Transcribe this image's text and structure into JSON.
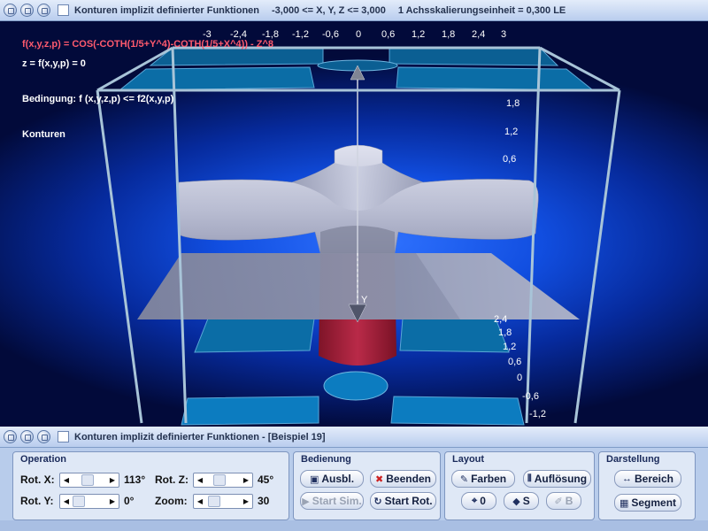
{
  "window": {
    "title": "Konturen implizit definierter Funktionen",
    "range_text": "-3,000 <= X, Y, Z <= 3,000",
    "scale_text": "1 Achsskalierungseinheit = 0,300 LE"
  },
  "overlay": {
    "formula": "f(x,y,z,p) = COS(-COTH(1/5+Y^4)-COTH(1/5+X^4)) - Z^8",
    "equation": "z = f(x,y,p) = 0",
    "condition": "Bedingung: f (x,y,z,p) <= f2(x,y,p)",
    "mode": "Konturen",
    "axis_label_y": "Y",
    "top_ticks": [
      "-3",
      "-2,4",
      "-1,8",
      "-1,2",
      "-0,6",
      "0",
      "0,6",
      "1,2",
      "1,8",
      "2,4",
      "3"
    ],
    "right_ticks": [
      "1,8",
      "1,2",
      "0,6"
    ],
    "right_ticks_low": [
      "2,4",
      "1,8",
      "1,2",
      "0,6",
      "0",
      "-0,6",
      "-1,2"
    ]
  },
  "panel_window": {
    "title": "Konturen implizit definierter Funktionen - [Beispiel 19]"
  },
  "operation": {
    "title": "Operation",
    "rot_x_label": "Rot. X:",
    "rot_x_value": "113°",
    "rot_y_label": "Rot. Y:",
    "rot_y_value": "0°",
    "rot_z_label": "Rot. Z:",
    "rot_z_value": "45°",
    "zoom_label": "Zoom:",
    "zoom_value": "30"
  },
  "bedienung": {
    "title": "Bedienung",
    "ausbl": "Ausbl.",
    "beenden": "Beenden",
    "start_sim": "Start Sim.",
    "start_rot": "Start Rot."
  },
  "layout": {
    "title": "Layout",
    "farben": "Farben",
    "aufloesung": "Auflösung",
    "zero": "0",
    "s": "S",
    "b": "B"
  },
  "darstellung": {
    "title": "Darstellung",
    "bereich": "Bereich",
    "segment": "Segment"
  },
  "colors": {
    "surface_silver": "#c8ccde",
    "surface_red": "#a8203c",
    "plane_gray": "#8a8fa6",
    "contour_cyan": "#1c8fd0",
    "frame": "#a8c4d8"
  }
}
